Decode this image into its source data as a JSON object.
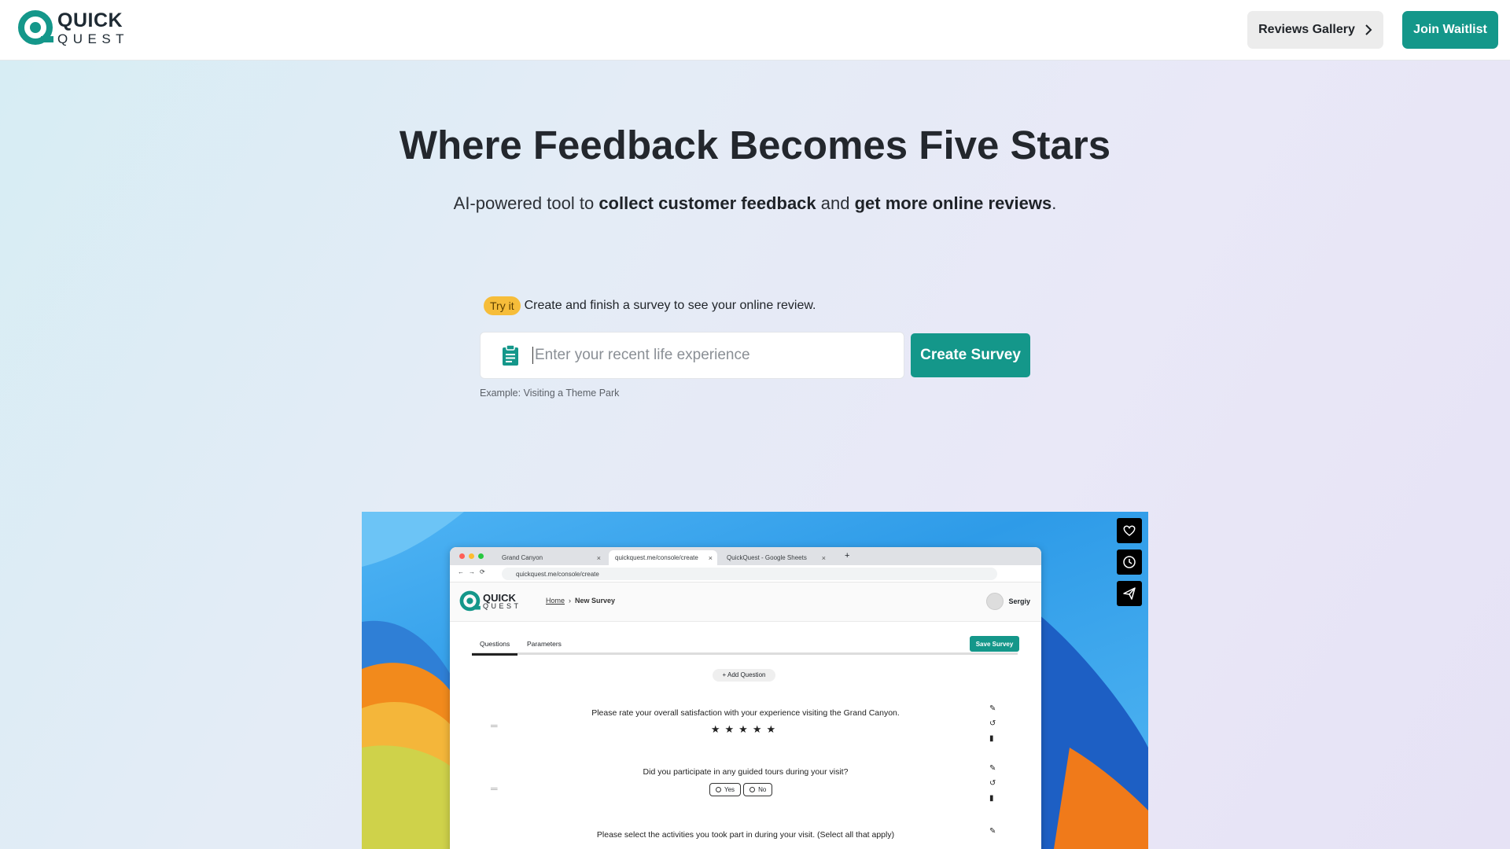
{
  "header": {
    "logo_line1": "QUICK",
    "logo_line2": "QUEST",
    "gallery_label": "Reviews Gallery",
    "waitlist_label": "Join Waitlist"
  },
  "hero": {
    "title": "Where Feedback Becomes Five Stars",
    "subtitle_part1": "AI-powered tool to ",
    "subtitle_bold1": "collect customer feedback",
    "subtitle_part2": " and ",
    "subtitle_bold2": "get more online reviews",
    "subtitle_part3": "."
  },
  "tryit": {
    "badge": "Try it",
    "text": "Create and finish a survey to see your online review."
  },
  "survey_input": {
    "placeholder": "Enter your recent life experience",
    "value": "",
    "button_label": "Create Survey",
    "example": "Example: Visiting a Theme Park"
  },
  "colors": {
    "brand": "#14978a",
    "badge": "#f6bd3a"
  },
  "video": {
    "side_buttons": [
      "heart-icon",
      "clock-icon",
      "send-icon"
    ],
    "browser": {
      "tabs": [
        {
          "label": "Grand Canyon",
          "active": false
        },
        {
          "label": "quickquest.me/console/create",
          "active": true
        },
        {
          "label": "QuickQuest - Google Sheets",
          "active": false
        }
      ],
      "url": "quickquest.me/console/create",
      "app_logo_line1": "QUICK",
      "app_logo_line2": "QUEST",
      "breadcrumb_home": "Home",
      "breadcrumb_current": "New Survey",
      "user_name": "Sergiy",
      "tab_questions": "Questions",
      "tab_parameters": "Parameters",
      "save_label": "Save Survey",
      "add_question": "+ Add Question",
      "questions": [
        "Please rate your overall satisfaction with your experience visiting the Grand Canyon.",
        "Did you participate in any guided tours during your visit?",
        "Please select the activities you took part in during your visit. (Select all that apply)"
      ],
      "stars": "★★★★★",
      "yes": "Yes",
      "no": "No"
    }
  }
}
